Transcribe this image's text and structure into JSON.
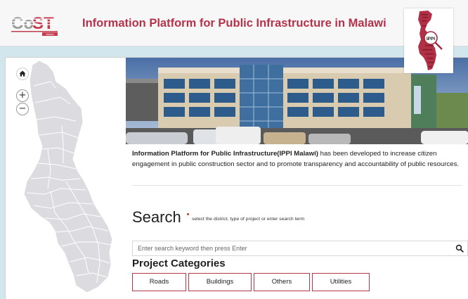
{
  "header": {
    "logo_text": "CoST",
    "logo_sub": "Malawi",
    "title": "Information Platform for Public Infrastructure in Malawi",
    "badge_text": "IPPI"
  },
  "intro": {
    "bold": "Information Platform for Public Infrastructure(IPPI Malawi)",
    "text": " has been developed to increase citizen engagement in public construction sector and to promote transparency and accountability of public resources."
  },
  "map_controls": {
    "home_icon": "home-icon",
    "zoom_in": "+",
    "zoom_out": "−"
  },
  "search": {
    "title": "Search",
    "hint": "select the district, type of project or enter search term",
    "placeholder": "Enter search keyword then press Enter"
  },
  "categories": {
    "title": "Project Categories",
    "items": [
      "Roads",
      "Buildings",
      "Others",
      "Utilities"
    ]
  },
  "colors": {
    "brand": "#b6324a",
    "background": "#d2e6ee",
    "map_fill": "#dcdce0"
  }
}
